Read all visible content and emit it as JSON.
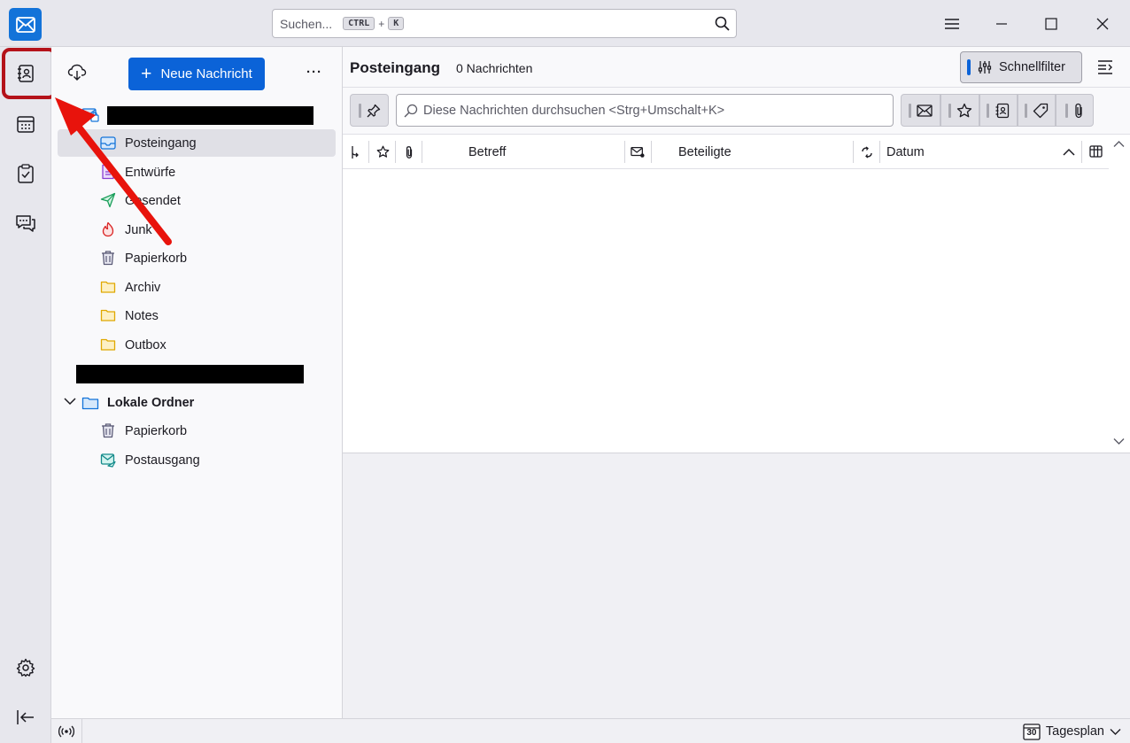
{
  "titlebar": {
    "search_placeholder": "Suchen...",
    "shortcut_key1": "CTRL",
    "shortcut_plus": "+",
    "shortcut_key2": "K"
  },
  "spaces": [
    "mail-icon",
    "address-book-icon",
    "calendar-icon",
    "tasks-icon",
    "chat-icon",
    "settings-icon",
    "collapse-icon"
  ],
  "folderpane": {
    "new_message_label": "Neue Nachricht",
    "more_label": "···",
    "account1_folders": [
      "Posteingang",
      "Entwürfe",
      "Gesendet",
      "Junk",
      "Papierkorb",
      "Archiv",
      "Notes",
      "Outbox"
    ],
    "local_folders_label": "Lokale Ordner",
    "local_folders": [
      "Papierkorb",
      "Postausgang"
    ]
  },
  "threadpane": {
    "folder_title": "Posteingang",
    "message_count": "0 Nachrichten",
    "quickfilter_label": "Schnellfilter",
    "filter_placeholder": "Diese Nachrichten durchsuchen <Strg+Umschalt+K>",
    "columns": {
      "subject": "Betreff",
      "correspondents": "Beteiligte",
      "date": "Datum"
    }
  },
  "statusbar": {
    "today_label": "Tagesplan",
    "calendar_day": "30"
  },
  "colors": {
    "accent": "#0b63d8",
    "highlight": "#b4121a",
    "arrow": "#e8130c"
  }
}
